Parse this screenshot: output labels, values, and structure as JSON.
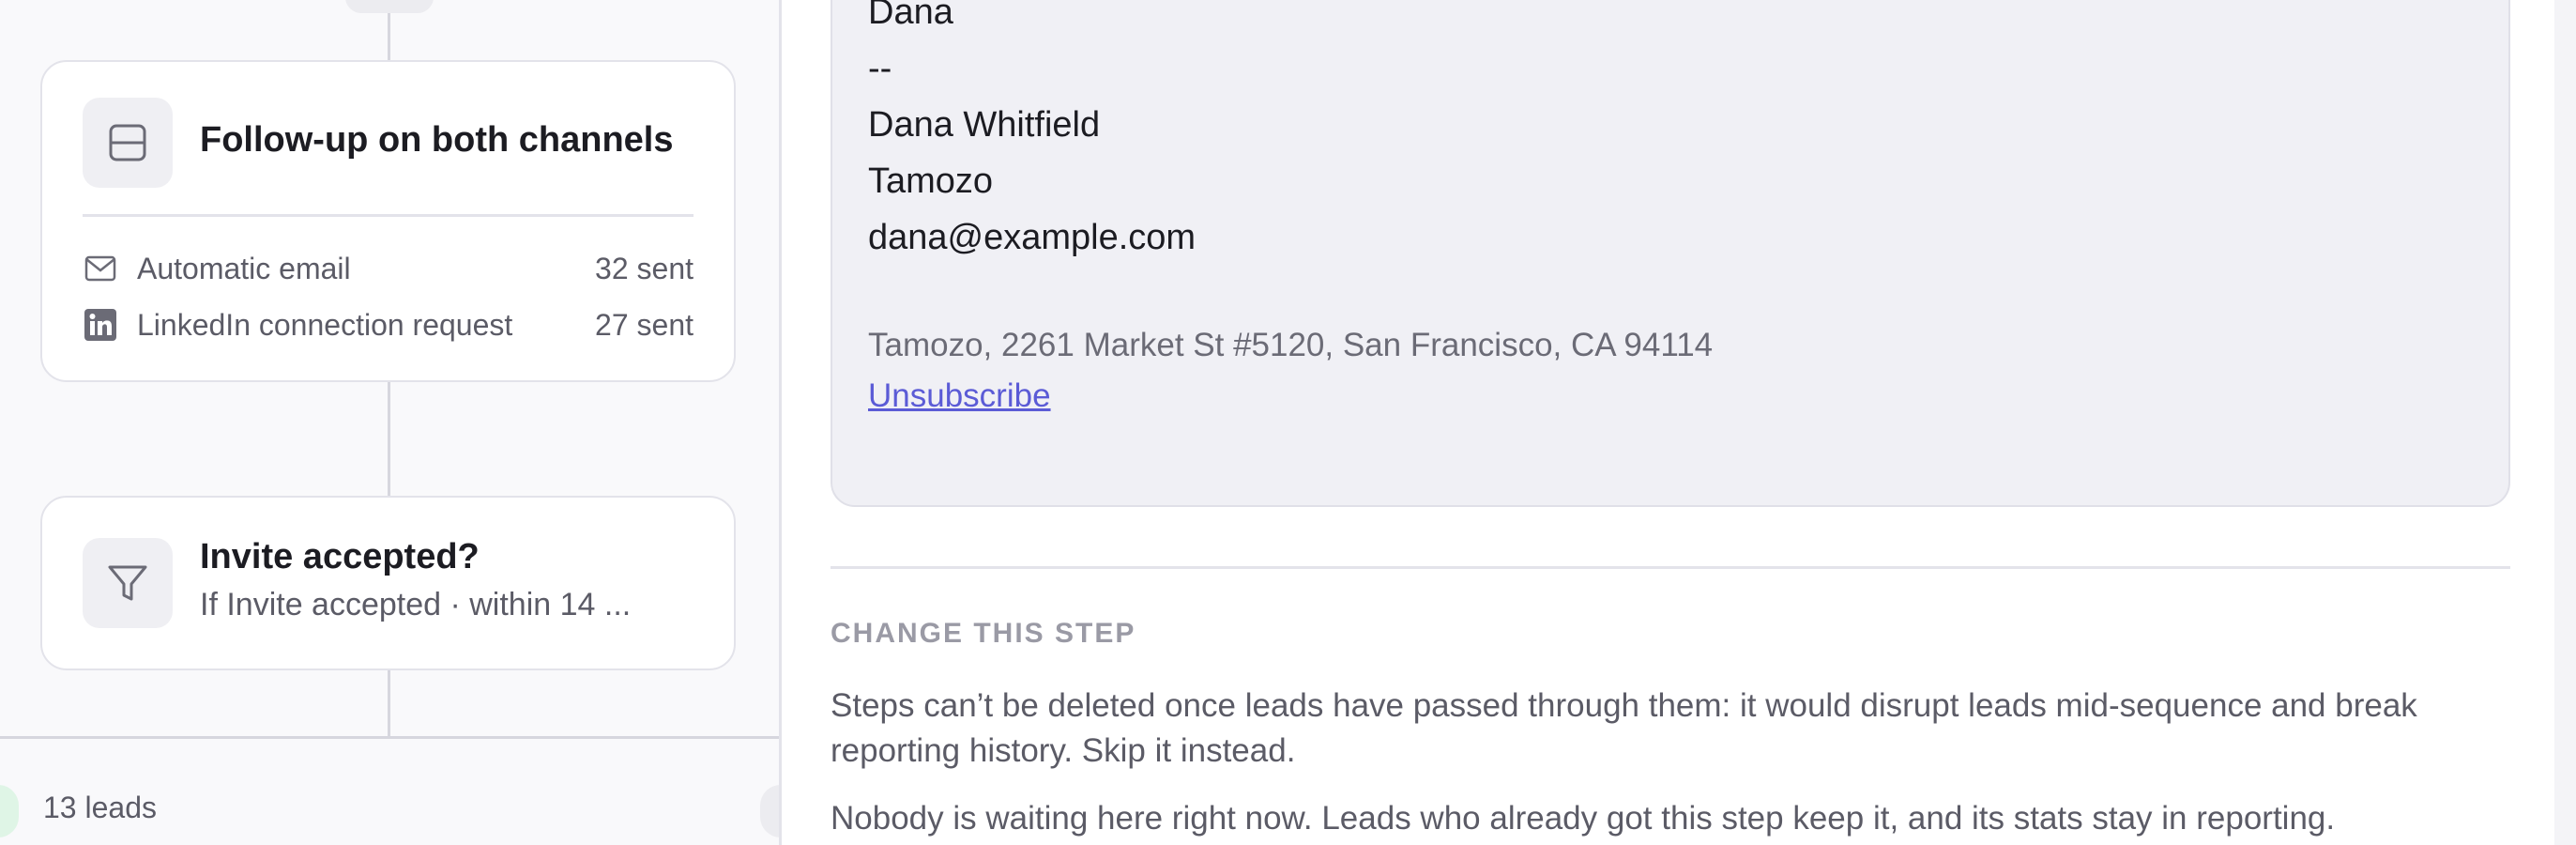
{
  "canvas": {
    "followup_card": {
      "title": "Follow-up on both channels",
      "icon": "split-box-icon",
      "channels": [
        {
          "icon": "mail-icon",
          "label": "Automatic email",
          "count": "32 sent"
        },
        {
          "icon": "linkedin-icon",
          "label": "LinkedIn connection request",
          "count": "27 sent"
        }
      ]
    },
    "condition_card": {
      "title": "Invite accepted?",
      "subtitle": "If Invite accepted · within 14 ...",
      "icon": "filter-icon"
    },
    "leads_label": "13 leads"
  },
  "email_preview": {
    "signoff_name": "Dana",
    "separator": "--",
    "signature_name": "Dana Whitfield",
    "signature_company": "Tamozo",
    "signature_email": "dana@example.com",
    "footer_address": "Tamozo, 2261 Market St #5120, San Francisco, CA 94114",
    "unsubscribe_label": "Unsubscribe"
  },
  "change_step": {
    "heading": "CHANGE THIS STEP",
    "paragraph_1": "Steps can’t be deleted once leads have passed through them: it would disrupt leads mid-sequence and break reporting history. Skip it instead.",
    "paragraph_2": "Nobody is waiting here right now. Leads who already got this step keep it, and its stats stay in reporting."
  },
  "colors": {
    "link": "#5b5bd6",
    "muted_text": "#5b5b66",
    "card_border": "#e3e3ea",
    "preview_bg": "#f0f0f5",
    "leads_dot": "#dff5e6"
  }
}
